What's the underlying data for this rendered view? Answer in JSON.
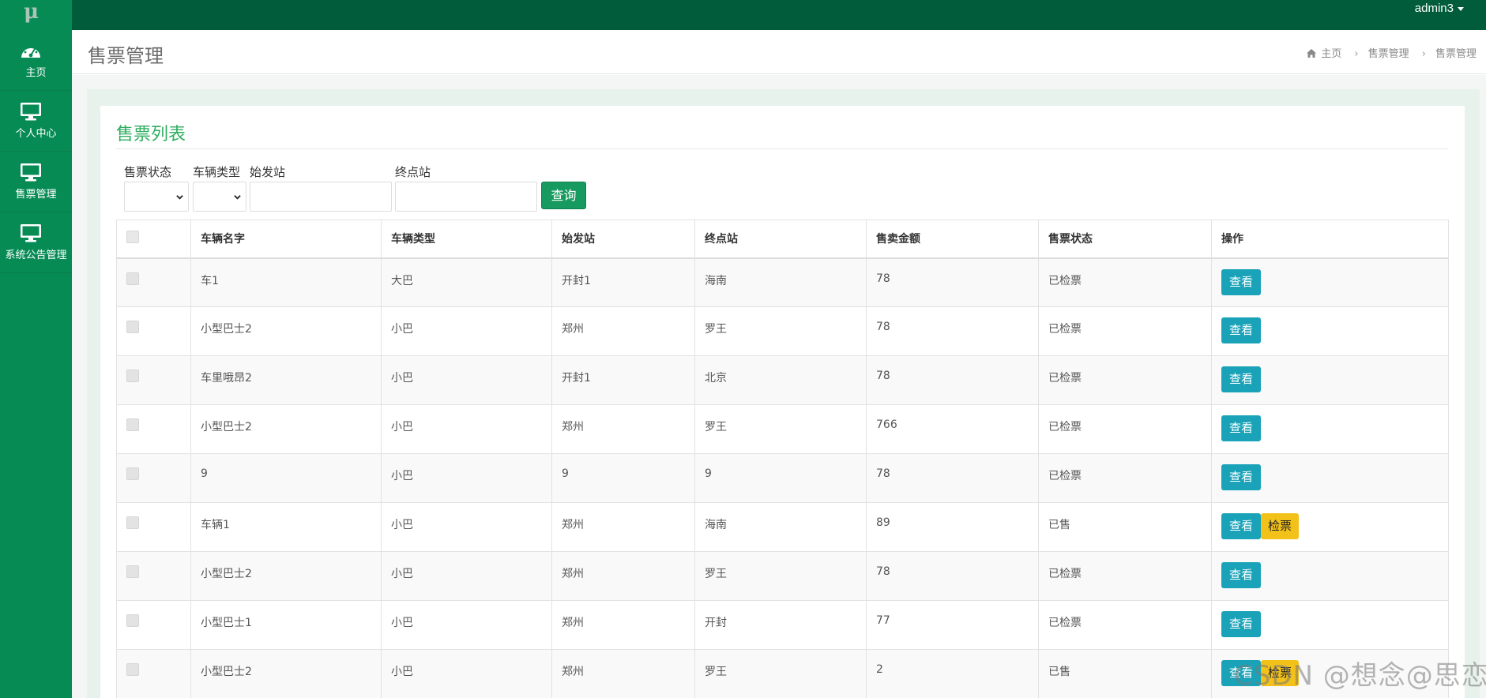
{
  "app": {
    "logo": "μ",
    "user": "admin3"
  },
  "sidebar": {
    "items": [
      {
        "label": "主页",
        "icon": "dashboard-icon"
      },
      {
        "label": "个人中心",
        "icon": "monitor-icon"
      },
      {
        "label": "售票管理",
        "icon": "monitor-icon"
      },
      {
        "label": "系统公告管理",
        "icon": "monitor-icon"
      }
    ]
  },
  "header": {
    "title": "售票管理",
    "breadcrumb": [
      "主页",
      "售票管理",
      "售票管理"
    ]
  },
  "panel": {
    "title": "售票列表"
  },
  "filters": {
    "status_label": "售票状态",
    "type_label": "车辆类型",
    "start_label": "始发站",
    "end_label": "终点站",
    "start_value": "",
    "end_value": "",
    "query_button": "查询"
  },
  "table": {
    "columns": [
      "车辆名字",
      "车辆类型",
      "始发站",
      "终点站",
      "售卖金额",
      "售票状态",
      "操作"
    ],
    "rows": [
      [
        "车1",
        "大巴",
        "开封1",
        "海南",
        "78",
        "已检票"
      ],
      [
        "小型巴士2",
        "小巴",
        "郑州",
        "罗王",
        "78",
        "已检票"
      ],
      [
        "车里哦昂2",
        "小巴",
        "开封1",
        "北京",
        "78",
        "已检票"
      ],
      [
        "小型巴士2",
        "小巴",
        "郑州",
        "罗王",
        "766",
        "已检票"
      ],
      [
        "9",
        "小巴",
        "9",
        "9",
        "78",
        "已检票"
      ],
      [
        "车辆1",
        "小巴",
        "郑州",
        "海南",
        "89",
        "已售"
      ],
      [
        "小型巴士2",
        "小巴",
        "郑州",
        "罗王",
        "78",
        "已检票"
      ],
      [
        "小型巴士1",
        "小巴",
        "郑州",
        "开封",
        "77",
        "已检票"
      ],
      [
        "小型巴士2",
        "小巴",
        "郑州",
        "罗王",
        "2",
        "已售"
      ]
    ],
    "view_button": "查看",
    "check_button": "检票"
  },
  "watermark": "CSDN @想念@思恋",
  "colors": {
    "topbar": "#015c3c",
    "sidebar": "#078b55",
    "accent": "#2eae5f",
    "view": "#1aa3b8",
    "check": "#f3c21a"
  }
}
